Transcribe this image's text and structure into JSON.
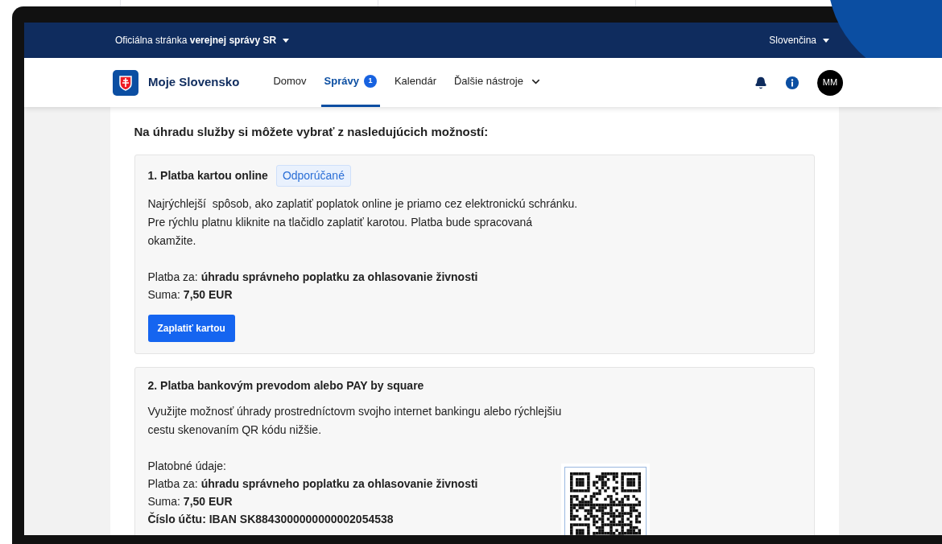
{
  "top_bar": {
    "label": "Oficiálna stránka **verejnej správy SR**",
    "language": "Slovenčina"
  },
  "header": {
    "logo_text": "Moje Slovensko",
    "nav": [
      {
        "label": "Domov",
        "selected": false
      },
      {
        "label": "Správy",
        "selected": true,
        "badge": "1"
      },
      {
        "label": "Kalendár",
        "selected": false
      },
      {
        "label": "Ďalšie nástroje",
        "selected": false,
        "dropdown": true
      }
    ],
    "avatar": "MM"
  },
  "heading": "Na úhradu služby si môžete vybrať z nasledujúcich možností:",
  "options": [
    {
      "title": "1. Platba kartou online",
      "tag": "Odporúčané",
      "description": [
        "Najrýchlejší  spôsob, ako zaplatiť poplatok online je priamo cez elektronickú schránku.",
        "Pre rýchlu platnu kliknite na tlačidlo zaplatiť karotou. Platba bude spracovaná",
        "okamžite."
      ],
      "lines": [
        {
          "text": "Platba za: **úhradu správneho poplatku za ohlasovanie živnosti**",
          "bold": false
        },
        {
          "text": "Suma: **7,50 EUR**",
          "bold": false
        }
      ],
      "button": "Zaplatiť kartou",
      "qr": false
    },
    {
      "title": "2. Platba bankovým prevodom alebo PAY by square",
      "description": [
        "Využijte možnosť úhrady prostredníctovm svojho internet bankingu alebo rýchlejšiu",
        "cestu skenovaním QR kódu nižšie."
      ],
      "lines": [
        {
          "text": "Platobné údaje:",
          "bold": false
        },
        {
          "text": "Platba za: **úhradu správneho poplatku za ohlasovanie živnosti**",
          "bold": false
        },
        {
          "text": "Suma: **7,50 EUR**",
          "bold": false
        },
        {
          "text": "Číslo účtu: IBAN SK8843000000000002054538",
          "bold": true
        }
      ],
      "qr": true
    }
  ]
}
